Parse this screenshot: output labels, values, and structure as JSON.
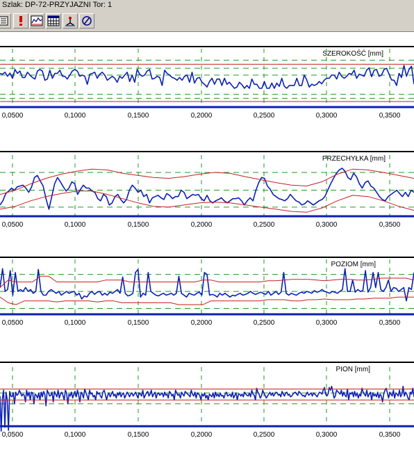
{
  "window": {
    "title": "Szlak: DP-72-PRZYJAZNI Tor: 1"
  },
  "toolbar": {
    "buttons": [
      {
        "icon": "list-icon"
      },
      {
        "icon": "exclamation-icon"
      },
      {
        "icon": "chart-icon"
      },
      {
        "icon": "calendar-table-icon"
      },
      {
        "icon": "marker-icon"
      },
      {
        "icon": "slashed-circle-icon"
      }
    ]
  },
  "colors": {
    "signal": "#0a1fb4",
    "limit": "#c81e1e",
    "grid": "#1e9a1e",
    "axis": "#0a1fb4",
    "frame": "#000000"
  },
  "chart_data": [
    {
      "type": "line",
      "title": "SZEROKOŚĆ [mm]",
      "xlim": [
        0.0425,
        0.3725
      ],
      "x_ticks": [
        "0,0500",
        "0,1000",
        "0,1500",
        "0,2000",
        "0,2500",
        "0,3000",
        "0,3500"
      ],
      "series": [
        {
          "role": "signal",
          "values": [
            52,
            50,
            55,
            45,
            53,
            40,
            62,
            52,
            58,
            42,
            42,
            55,
            48,
            42,
            38,
            58,
            62,
            58,
            35,
            38,
            60,
            40,
            52,
            52,
            60,
            45,
            45,
            38,
            48,
            58,
            62,
            58,
            45,
            48,
            45,
            25,
            50,
            52,
            55,
            40,
            50,
            55,
            48,
            35,
            40,
            45,
            40,
            30,
            45,
            40,
            48,
            55,
            32,
            48,
            30,
            62,
            50,
            45,
            48,
            58,
            62,
            38,
            40,
            45,
            42,
            22,
            60,
            52,
            48,
            42,
            40,
            35,
            42,
            35,
            45,
            48,
            30,
            55,
            28,
            40,
            42,
            30,
            25,
            18,
            32,
            40,
            25,
            38,
            38,
            22,
            40,
            25,
            30,
            22,
            15,
            18,
            30,
            24,
            15,
            22,
            15,
            38,
            25,
            25,
            15,
            15,
            32,
            15,
            15,
            28,
            15,
            28,
            20,
            40,
            20,
            15,
            22,
            22,
            22,
            40,
            22,
            22,
            48,
            36,
            18,
            25,
            22,
            25,
            32,
            26,
            35,
            40,
            40,
            48,
            48,
            38,
            55,
            45,
            40,
            45,
            52,
            50,
            60,
            40,
            50,
            48,
            45,
            60,
            66,
            44,
            60,
            62,
            45,
            48,
            62,
            65,
            50,
            36,
            35,
            22,
            52,
            42,
            72,
            45,
            62,
            70,
            25
          ]
        },
        {
          "role": "limit",
          "values": [
            75,
            75
          ]
        },
        {
          "role": "limit",
          "values": [
            -18,
            -18
          ]
        }
      ],
      "grid_levels": [
        85,
        65,
        48,
        0,
        -10
      ]
    },
    {
      "type": "line",
      "title": "PRZECHYŁKA [mm]",
      "xlim": [
        0.0425,
        0.3725
      ],
      "x_ticks": [
        "0,0500",
        "0,1000",
        "0,1500",
        "0,2000",
        "0,2500",
        "0,3000",
        "0,3500"
      ],
      "series": [
        {
          "role": "signal",
          "values": [
            -5,
            5,
            22,
            28,
            35,
            30,
            38,
            40,
            42,
            35,
            25,
            38,
            60,
            65,
            52,
            40,
            10,
            -15,
            15,
            45,
            60,
            50,
            38,
            28,
            35,
            50,
            45,
            20,
            32,
            42,
            35,
            35,
            28,
            25,
            10,
            5,
            20,
            15,
            -5,
            0,
            15,
            20,
            8,
            0,
            8,
            30,
            42,
            35,
            25,
            30,
            15,
            20,
            0,
            12,
            15,
            18,
            12,
            8,
            22,
            18,
            10,
            15,
            15,
            30,
            25,
            10,
            15,
            20,
            18,
            20,
            10,
            5,
            18,
            5,
            0,
            5,
            8,
            12,
            5,
            0,
            5,
            10,
            10,
            12,
            5,
            -5,
            5,
            12,
            5,
            30,
            48,
            60,
            58,
            40,
            32,
            20,
            15,
            10,
            8,
            5,
            10,
            20,
            12,
            5,
            2,
            -5,
            -2,
            5,
            0,
            -5,
            0,
            5,
            8,
            15,
            30,
            45,
            58,
            70,
            78,
            82,
            75,
            60,
            55,
            70,
            62,
            45,
            35,
            48,
            52,
            40,
            35,
            25,
            15,
            8,
            5,
            15,
            20,
            25,
            30,
            22,
            15,
            25,
            15,
            30,
            25
          ]
        },
        {
          "role": "limit",
          "values": [
            20,
            30,
            45,
            58,
            68,
            75,
            80,
            78,
            70,
            65,
            60,
            58,
            62,
            68,
            72,
            70,
            62,
            55,
            48,
            42,
            40,
            50,
            68,
            80,
            78,
            72,
            65,
            58
          ]
        },
        {
          "role": "limit",
          "values": [
            -15,
            -8,
            5,
            15,
            22,
            28,
            28,
            20,
            10,
            0,
            -8,
            -10,
            -5,
            0,
            2,
            0,
            -5,
            -10,
            -15,
            -20,
            -22,
            -12,
            5,
            18,
            15,
            5,
            -8,
            -18
          ]
        }
      ],
      "grid_levels": [
        72,
        30,
        -10
      ]
    },
    {
      "type": "line",
      "title": "POZIOM [mm]",
      "xlim": [
        0.0425,
        0.3725
      ],
      "x_ticks": [
        "0,0500",
        "0,1000",
        "0,1500",
        "0,2000",
        "0,2500",
        "0,3000",
        "0,3500"
      ],
      "series": [
        {
          "role": "signal",
          "values": [
            40,
            90,
            30,
            35,
            85,
            20,
            80,
            30,
            35,
            30,
            40,
            30,
            35,
            25,
            30,
            88,
            30,
            20,
            20,
            30,
            35,
            30,
            25,
            30,
            20,
            25,
            30,
            25,
            28,
            30,
            20,
            25,
            10,
            18,
            15,
            25,
            30,
            22,
            28,
            30,
            20,
            25,
            20,
            28,
            25,
            30,
            35,
            25,
            68,
            25,
            18,
            20,
            25,
            80,
            88,
            15,
            25,
            20,
            80,
            30,
            25,
            20,
            18,
            22,
            25,
            20,
            22,
            25,
            20,
            25,
            70,
            25,
            20,
            15,
            25,
            22,
            20,
            25,
            28,
            20,
            80,
            75,
            20,
            22,
            20,
            15,
            25,
            20,
            25,
            20,
            15,
            20,
            18,
            22,
            25,
            20,
            22,
            25,
            30,
            25,
            22,
            25,
            28,
            25,
            22,
            30,
            20,
            25,
            30,
            22,
            28,
            80,
            25,
            20,
            25,
            22,
            20,
            25,
            28,
            25,
            30,
            28,
            25,
            32,
            28,
            30,
            35,
            30,
            28,
            25,
            30,
            28,
            25,
            30,
            35,
            90,
            30,
            30,
            60,
            28,
            35,
            30,
            32,
            85,
            28,
            40,
            80,
            40,
            80,
            35,
            30,
            40,
            60,
            30,
            40,
            38,
            30,
            35,
            40,
            5,
            40,
            35,
            80
          ]
        },
        {
          "role": "limit",
          "values": [
            40,
            60,
            55,
            55,
            55,
            70,
            70,
            55,
            55,
            55,
            55,
            55,
            55,
            60,
            60,
            60,
            55,
            55,
            55,
            55,
            55,
            55,
            55,
            55,
            55,
            60,
            60,
            55,
            55,
            55,
            55,
            55,
            55,
            58,
            58,
            60,
            62,
            62,
            62,
            60,
            58,
            60,
            62,
            62,
            60,
            60,
            62,
            65,
            65,
            65,
            65,
            60
          ]
        },
        {
          "role": "limit",
          "values": [
            15,
            0,
            -5,
            5,
            5,
            5,
            5,
            2,
            5,
            5,
            5,
            5,
            2,
            5,
            5,
            0,
            0,
            0,
            0,
            0,
            0,
            0,
            -5,
            -5,
            -5,
            -5,
            5,
            5,
            5,
            5,
            5,
            5,
            5,
            8,
            8,
            8,
            5,
            5,
            8,
            8,
            10,
            8,
            8,
            8,
            10,
            10,
            12,
            12,
            12,
            15,
            15,
            15
          ]
        }
      ],
      "grid_levels": [
        75,
        30,
        -15
      ]
    },
    {
      "type": "line",
      "title": "PION [mm]",
      "xlim": [
        0.0425,
        0.3725
      ],
      "x_ticks": [
        "0,0500",
        "0,1000",
        "0,1500",
        "0,2000",
        "0,2500",
        "0,3000",
        "0,3500"
      ],
      "series": [
        {
          "role": "signal",
          "values": [
            40,
            -50,
            35,
            55,
            -40,
            50,
            30,
            -48,
            52,
            40,
            38,
            48,
            20,
            50,
            42,
            45,
            55,
            48,
            40,
            45,
            42,
            25,
            55,
            40,
            50,
            30,
            50,
            48,
            20,
            45,
            42,
            35,
            48,
            30,
            50,
            38,
            52,
            45,
            15,
            55,
            48,
            40,
            42,
            50,
            25,
            52,
            45,
            38,
            55,
            35,
            45,
            50,
            42,
            30,
            55,
            48,
            20,
            45,
            40,
            50,
            35,
            45,
            52,
            38,
            55,
            42,
            25,
            50,
            45,
            35,
            58,
            48,
            40,
            30,
            55,
            45,
            48,
            38,
            42,
            30,
            52,
            45,
            48,
            40,
            35,
            50,
            55,
            45,
            30,
            42,
            48,
            38,
            45,
            52,
            40,
            45,
            35,
            48,
            42,
            50,
            38,
            45,
            48,
            35,
            42,
            50,
            45,
            38,
            45,
            48,
            40,
            45,
            50,
            42,
            35,
            48,
            45,
            40,
            55,
            35,
            42,
            48,
            52,
            40,
            45,
            55,
            38,
            45,
            50,
            35,
            45,
            48,
            42,
            45,
            48,
            38,
            50,
            42,
            45,
            35,
            52,
            48,
            40,
            45,
            30,
            55,
            48,
            42,
            45,
            35,
            50,
            45,
            40,
            52,
            48,
            45,
            42,
            38,
            55,
            45,
            40,
            50,
            35,
            48,
            45,
            42,
            30,
            45,
            40,
            48,
            35,
            42,
            30,
            45,
            42,
            38,
            48,
            35,
            50,
            40,
            45,
            38,
            48,
            40,
            42,
            35,
            45,
            50,
            40,
            42,
            45,
            38,
            50,
            35,
            42,
            48,
            30,
            45,
            45,
            40,
            45,
            38,
            50,
            45,
            42,
            40,
            48,
            38,
            55,
            45,
            42,
            30,
            60,
            50,
            45,
            35,
            40,
            55,
            48,
            42,
            35,
            40,
            45,
            50,
            42,
            48,
            40,
            45,
            50,
            48,
            42,
            45,
            38,
            52,
            45,
            40,
            48,
            50,
            42,
            45,
            38,
            40,
            45,
            48,
            50,
            45,
            42,
            52,
            48,
            45,
            40,
            42,
            38,
            45,
            50,
            42,
            45,
            48,
            40,
            48,
            45,
            42,
            38,
            45,
            50,
            48,
            45,
            55,
            62,
            45,
            40,
            45,
            62,
            55,
            65,
            50,
            35,
            40,
            55,
            52,
            48,
            45,
            55,
            40,
            50,
            42,
            38,
            58,
            30,
            48,
            45,
            50,
            38,
            52,
            40,
            48,
            35,
            45,
            40,
            60,
            50,
            45,
            40,
            55,
            38,
            45,
            50,
            30,
            48,
            40,
            45,
            38,
            50,
            35,
            45,
            40,
            25,
            45,
            55,
            60,
            48,
            35,
            50,
            45,
            40,
            55,
            35,
            48,
            45,
            40,
            55,
            38,
            45,
            65,
            40,
            50,
            45,
            35,
            30,
            50,
            45,
            60,
            38
          ]
        },
        {
          "role": "limit",
          "values": [
            58,
            58
          ]
        },
        {
          "role": "limit",
          "values": [
            30,
            30
          ]
        }
      ],
      "grid_levels": [
        48,
        20
      ]
    }
  ]
}
